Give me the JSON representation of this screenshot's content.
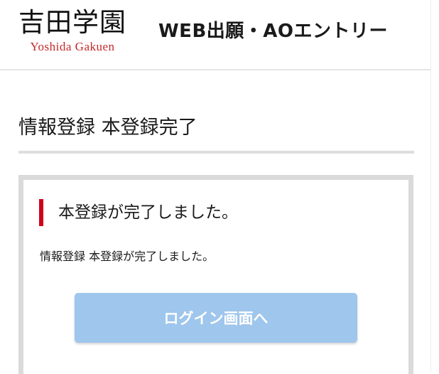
{
  "header": {
    "logo_kanji": "吉田学園",
    "logo_roman": "Yoshida Gakuen",
    "site_title": "WEB出願・AOエントリー"
  },
  "main": {
    "page_title": "情報登録 本登録完了",
    "panel": {
      "heading": "本登録が完了しました。",
      "message": "情報登録 本登録が完了しました。",
      "button_label": "ログイン画面へ"
    }
  },
  "colors": {
    "accent_red": "#d0021b",
    "logo_red": "#c62828",
    "button_blue": "#9fc6ec",
    "panel_border": "#dadada"
  }
}
